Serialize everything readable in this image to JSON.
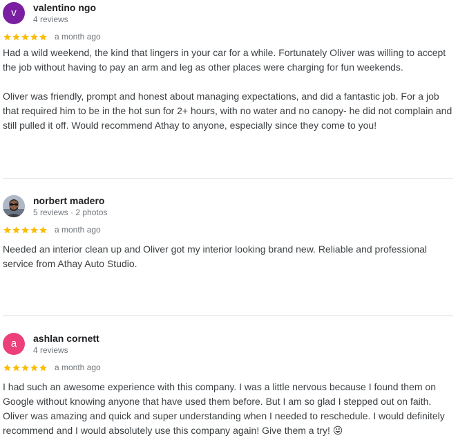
{
  "reviews": [
    {
      "author": "valentino ngo",
      "avatar_letter": "v",
      "avatar_color": "#7b1fa2",
      "meta": "4 reviews",
      "rating": 5,
      "when": "a month ago",
      "text": "Had a wild weekend, the kind that lingers in your car for a while. Fortunately Oliver was willing to accept the job without having to pay an arm and leg as other places were charging for fun weekends.\n\nOliver was friendly, prompt and honest about managing expectations, and did a fantastic job. For a job that required him to be in the hot sun for 2+ hours, with no water and no canopy- he did not complain and still pulled it off. Would recommend Athay to anyone, especially since they come to you!"
    },
    {
      "author": "norbert madero",
      "avatar_icon": "user-photo-icon",
      "meta": "5 reviews · 2 photos",
      "rating": 5,
      "when": "a month ago",
      "text": "Needed an interior clean up and Oliver got my interior looking brand new. Reliable and professional service from Athay Auto Studio."
    },
    {
      "author": "ashlan cornett",
      "avatar_letter": "a",
      "avatar_color": "#ec407a",
      "meta": "4 reviews",
      "rating": 5,
      "when": "a month ago",
      "text": "I had such an awesome experience with this company. I was a little nervous because I found them on Google without knowing anyone that have used them before. But I am so glad I stepped out on faith. Oliver was amazing and quick and super understanding when I needed to reschedule. I would definitely recommend and I would absolutely use this company again! Give them a try! 😜"
    }
  ],
  "star_color": "#fbbc04"
}
